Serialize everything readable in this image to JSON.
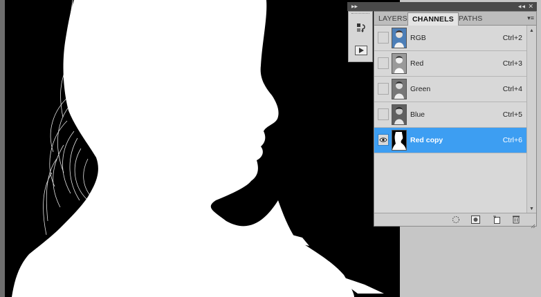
{
  "topbar": {
    "collapse_glyph": "▸▸",
    "right_glyph": "◂◂ ✕"
  },
  "tool_strip": {
    "buttons": [
      {
        "icon": "history-brush-icon"
      },
      {
        "icon": "actions-play-icon"
      }
    ]
  },
  "panel": {
    "tabs": [
      {
        "label": "LAYERS",
        "active": false
      },
      {
        "label": "CHANNELS",
        "active": true
      },
      {
        "label": "PATHS",
        "active": false
      }
    ],
    "menu_glyph": "▾≡",
    "channels": [
      {
        "name": "RGB",
        "shortcut": "Ctrl+2",
        "visible": false,
        "selected": false,
        "thumb": "color"
      },
      {
        "name": "Red",
        "shortcut": "Ctrl+3",
        "visible": false,
        "selected": false,
        "thumb": "gray"
      },
      {
        "name": "Green",
        "shortcut": "Ctrl+4",
        "visible": false,
        "selected": false,
        "thumb": "gray"
      },
      {
        "name": "Blue",
        "shortcut": "Ctrl+5",
        "visible": false,
        "selected": false,
        "thumb": "gray"
      },
      {
        "name": "Red copy",
        "shortcut": "Ctrl+6",
        "visible": true,
        "selected": true,
        "thumb": "mask"
      }
    ],
    "footer_buttons": [
      {
        "icon": "load-selection-icon"
      },
      {
        "icon": "save-selection-icon"
      },
      {
        "icon": "new-channel-icon"
      },
      {
        "icon": "delete-channel-icon"
      }
    ],
    "colors": {
      "selected": "#3d9ef2",
      "panel_bg": "#d8d8d8"
    }
  }
}
